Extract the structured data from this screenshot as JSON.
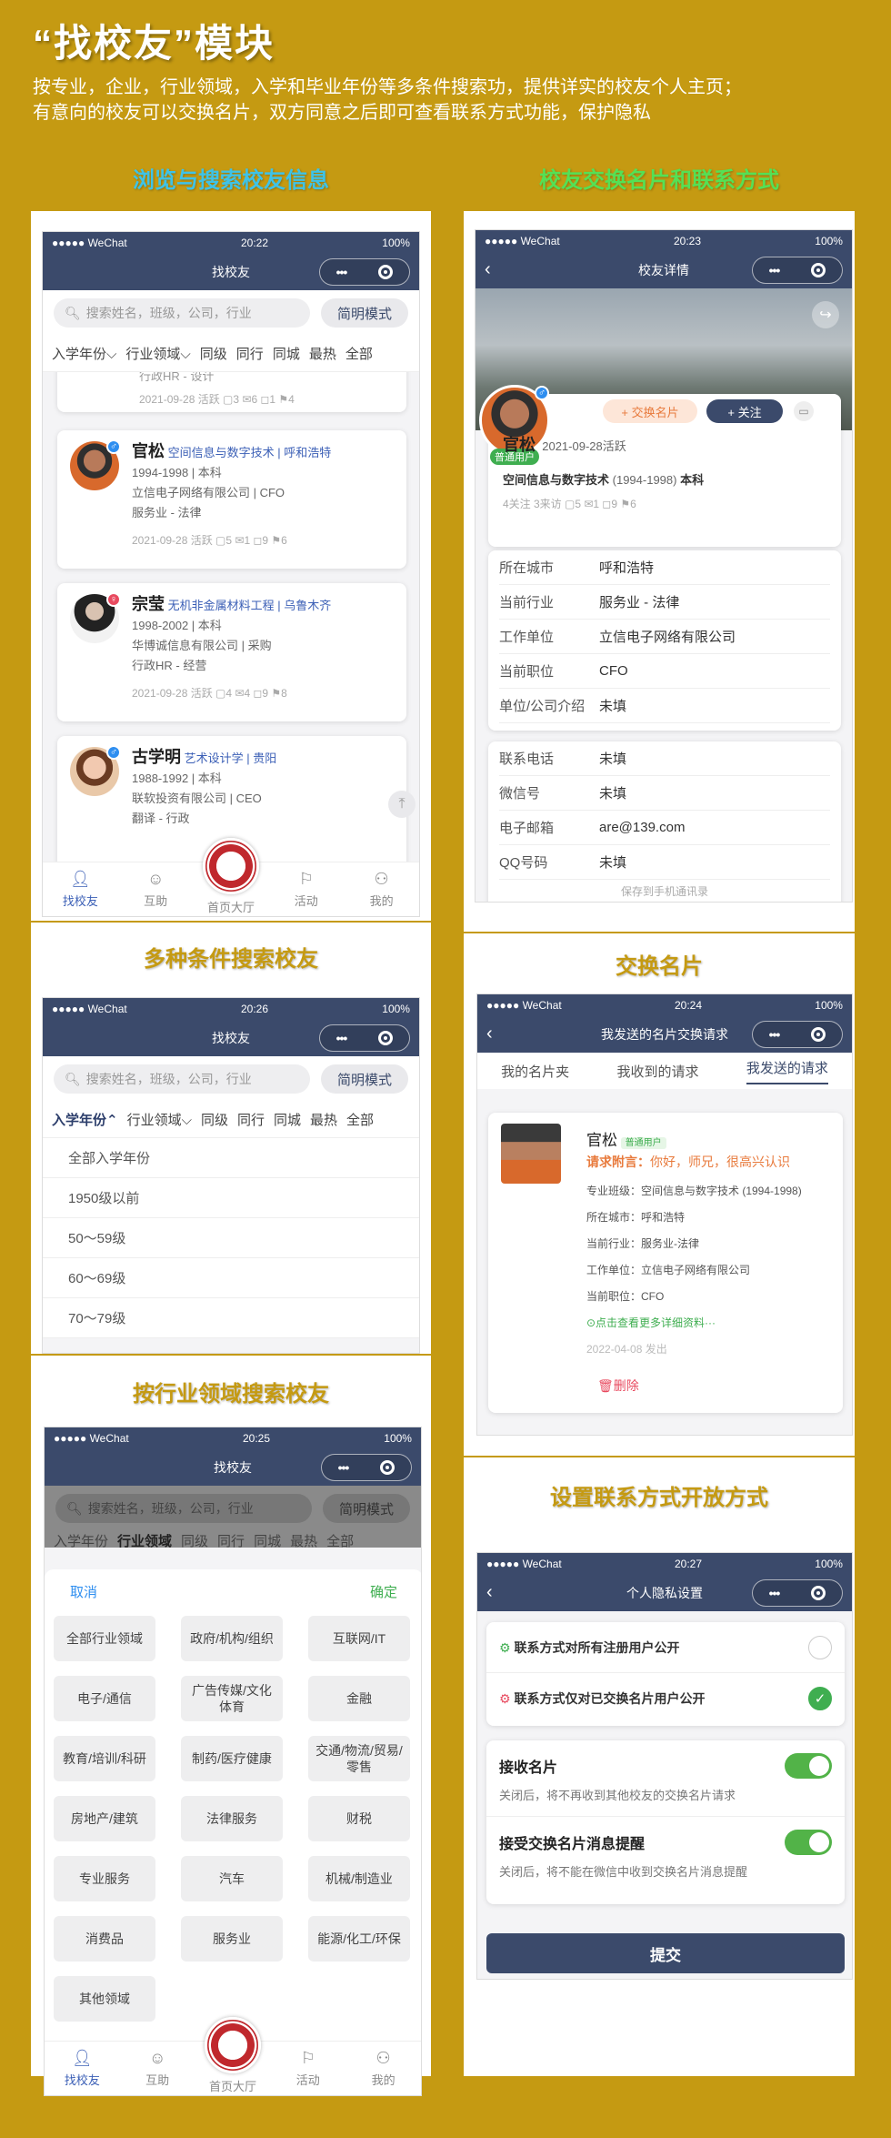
{
  "header": {
    "title": "“找校友”模块",
    "desc1": "按专业，企业，行业领域，入学和毕业年份等多条件搜索功，提供详实的校友个人主页；",
    "desc2": "有意向的校友可以交换名片，双方同意之后即可查看联系方式功能，保护隐私"
  },
  "sections": {
    "browse": "浏览与搜索校友信息",
    "exchange": "校友交换名片和联系方式",
    "multi": "多种条件搜索校友",
    "industry": "按行业领域搜索校友",
    "cards": "交换名片",
    "privacy": "设置联系方式开放方式"
  },
  "common": {
    "carrier": "●●●●● WeChat",
    "battery": "100%",
    "search_ph": "搜索姓名，班级，公司，行业",
    "simple": "简明模式",
    "filters": [
      "入学年份",
      "行业领域",
      "同级",
      "同行",
      "同城",
      "最热",
      "全部"
    ],
    "tabs": [
      "找校友",
      "互助",
      "首页大厅",
      "活动",
      "我的"
    ]
  },
  "list": {
    "time": "20:22",
    "title": "找校友",
    "partial": {
      "line": "行政HR - 设计",
      "meta": "2021-09-28 活跃   ▢3   ✉6   ◻1   ⚑4"
    },
    "people": [
      {
        "name": "官松",
        "major": "空间信息与数字技术 | 呼和浩特",
        "l1": "1994-1998 | 本科",
        "l2": "立信电子网络有限公司 | CFO",
        "l3": "服务业 - 法律",
        "meta": "2021-09-28 活跃   ▢5   ✉1   ◻9   ⚑6"
      },
      {
        "name": "宗莹",
        "major": "无机非金属材料工程 | 乌鲁木齐",
        "l1": "1998-2002 | 本科",
        "l2": "华博诚信息有限公司 | 采购",
        "l3": "行政HR - 经营",
        "meta": "2021-09-28 活跃   ▢4   ✉4   ◻9   ⚑8"
      },
      {
        "name": "古学明",
        "major": "艺术设计学 | 贵阳",
        "l1": "1988-1992 | 本科",
        "l2": "联软投资有限公司 | CEO",
        "l3": "翻译 - 行政",
        "meta": ""
      }
    ]
  },
  "detail": {
    "time": "20:23",
    "title": "校友详情",
    "tag": "普通用户",
    "exchange_btn": "+ 交换名片",
    "follow_btn": "+ 关注",
    "name": "官松",
    "active": "2021-09-28活跃",
    "major": "空间信息与数字技术",
    "years": "(1994-1998)",
    "degree": "本科",
    "stats": "4关注   3来访   ▢5   ✉1   ◻9   ⚑6",
    "info": [
      {
        "k": "所在城市",
        "v": "呼和浩特"
      },
      {
        "k": "当前行业",
        "v": "服务业 - 法律"
      },
      {
        "k": "工作单位",
        "v": "立信电子网络有限公司"
      },
      {
        "k": "当前职位",
        "v": "CFO"
      },
      {
        "k": "单位/公司介绍",
        "v": "未填"
      }
    ],
    "contact": [
      {
        "k": "联系电话",
        "v": "未填"
      },
      {
        "k": "微信号",
        "v": "未填"
      },
      {
        "k": "电子邮箱",
        "v": "are@139.com"
      },
      {
        "k": "QQ号码",
        "v": "未填"
      }
    ],
    "more": "保存到手机通讯录"
  },
  "filter": {
    "time": "20:26",
    "title": "找校友",
    "options": [
      "全部入学年份",
      "1950级以前",
      "50～59级",
      "60～69级",
      "70～79级"
    ]
  },
  "industry": {
    "time": "20:25",
    "title": "找校友",
    "cancel": "取消",
    "confirm": "确定",
    "items": [
      "全部行业领域",
      "政府/机构/组织",
      "互联网/IT",
      "电子/通信",
      "广告传媒/文化体育",
      "金融",
      "教育/培训/科研",
      "制药/医疗健康",
      "交通/物流/贸易/零售",
      "房地产/建筑",
      "法律服务",
      "财税",
      "专业服务",
      "汽车",
      "机械/制造业",
      "消费品",
      "服务业",
      "能源/化工/环保",
      "其他领域"
    ]
  },
  "requests": {
    "time": "20:24",
    "title": "我发送的名片交换请求",
    "tabs": [
      "我的名片夹",
      "我收到的请求",
      "我发送的请求"
    ],
    "name": "官松",
    "tag": "普通用户",
    "note_k": "请求附言：",
    "note_v": "你好，师兄，很高兴认识",
    "rows": [
      "专业班级：空间信息与数字技术 (1994-1998)",
      "所在城市：呼和浩特",
      "当前行业：服务业-法律",
      "工作单位：立信电子网络有限公司",
      "当前职位：CFO"
    ],
    "more": "⊙点击查看更多详细资料···",
    "date": "2022-04-08 发出",
    "del": "删除"
  },
  "privacy": {
    "time": "20:27",
    "title": "个人隐私设置",
    "opt1": "联系方式对所有注册用户公开",
    "opt2": "联系方式仅对已交换名片用户公开",
    "s1t": "接收名片",
    "s1d": "关闭后，将不再收到其他校友的交换名片请求",
    "s2t": "接受交换名片消息提醒",
    "s2d": "关闭后，将不能在微信中收到交换名片消息提醒",
    "submit": "提交"
  }
}
